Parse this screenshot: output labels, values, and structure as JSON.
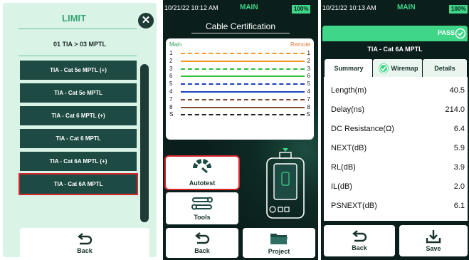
{
  "colors": {
    "accent_green": "#3fd688",
    "dark_teal": "#1d4a43",
    "screen_dark": "#0a1f1c",
    "limit_bg": "#d9f3e6",
    "selection_red": "#d8262f",
    "wire_orange": "#f39a2b",
    "wire_green": "#2bbf3c",
    "wire_blue": "#1f3fbf",
    "wire_brown": "#7a4a2a",
    "wire_shield": "#222222"
  },
  "limit_screen": {
    "title": "LIMIT",
    "close_icon": "close-icon",
    "subtitle": "01 TIA > 03 MPTL",
    "items": [
      {
        "label": "TIA - Cat 5e MPTL (+)",
        "selected": false
      },
      {
        "label": "TIA - Cat 5e MPTL",
        "selected": false
      },
      {
        "label": "TIA - Cat 6 MPTL (+)",
        "selected": false
      },
      {
        "label": "TIA - Cat 6 MPTL",
        "selected": false
      },
      {
        "label": "TIA - Cat 6A MPTL (+)",
        "selected": false
      },
      {
        "label": "TIA - Cat 6A MPTL",
        "selected": true
      }
    ],
    "back_label": "Back"
  },
  "main_screen": {
    "status": {
      "time": "10/21/22 10:12 AM",
      "mode": "MAIN",
      "battery": "100%"
    },
    "heading": "Cable Certification",
    "wiremap": {
      "main_label": "Main",
      "remote_label": "Remote",
      "rows": [
        {
          "left": "1",
          "right": "1",
          "color": "#f39a2b",
          "style": "dashed"
        },
        {
          "left": "2",
          "right": "2",
          "color": "#f39a2b",
          "style": "solid"
        },
        {
          "left": "3",
          "right": "3",
          "color": "#2bbf3c",
          "style": "dashed"
        },
        {
          "left": "6",
          "right": "6",
          "color": "#2bbf3c",
          "style": "solid"
        },
        {
          "left": "5",
          "right": "5",
          "color": "#1f3fbf",
          "style": "dashed"
        },
        {
          "left": "4",
          "right": "4",
          "color": "#1f3fbf",
          "style": "solid"
        },
        {
          "left": "7",
          "right": "7",
          "color": "#7a4a2a",
          "style": "dashed"
        },
        {
          "left": "8",
          "right": "8",
          "color": "#7a4a2a",
          "style": "solid"
        },
        {
          "left": "S",
          "right": "S",
          "color": "#222222",
          "style": "dashed"
        }
      ]
    },
    "autotest_label": "Autotest",
    "tools_label": "Tools",
    "back_label": "Back",
    "project_label": "Project"
  },
  "result_screen": {
    "status": {
      "time": "10/21/22 10:13 AM",
      "mode": "MAIN",
      "battery": "100%"
    },
    "pass_label": "PASS",
    "standard": "TIA - Cat 6A MPTL",
    "tabs": [
      {
        "label": "Summary",
        "active": true
      },
      {
        "label": "Wiremap",
        "active": false
      },
      {
        "label": "Details",
        "active": false
      }
    ],
    "results": [
      {
        "label": "Length(m)",
        "value": "40.5"
      },
      {
        "label": "Delay(ns)",
        "value": "214.0"
      },
      {
        "label": "DC Resistance(Ω)",
        "value": "6.4"
      },
      {
        "label": "NEXT(dB)",
        "value": "5.9"
      },
      {
        "label": "RL(dB)",
        "value": "3.9"
      },
      {
        "label": "IL(dB)",
        "value": "2.0"
      },
      {
        "label": "PSNEXT(dB)",
        "value": "6.1"
      }
    ],
    "back_label": "Back",
    "save_label": "Save"
  }
}
